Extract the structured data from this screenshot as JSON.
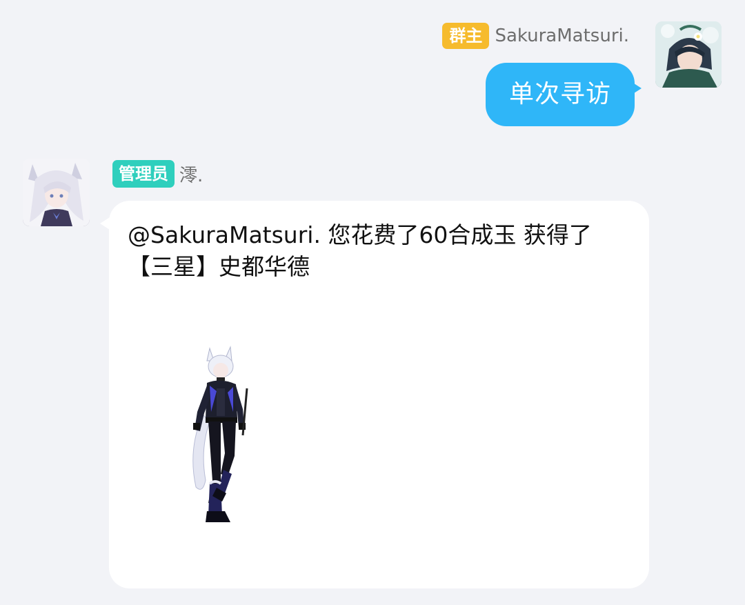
{
  "messages": {
    "outgoing": {
      "role_badge": "群主",
      "sender_name": "SakuraMatsuri.",
      "text": "单次寻访"
    },
    "incoming": {
      "role_badge": "管理员",
      "sender_name": "澪.",
      "line1": "@SakuraMatsuri. 您花费了60合成玉 获得了",
      "line2": "【三星】史都华德"
    }
  },
  "colors": {
    "background": "#f2f3f7",
    "owner_badge": "#f6bb2d",
    "admin_badge": "#2fcfbd",
    "outgoing_bubble": "#2fb6f8",
    "incoming_bubble": "#ffffff"
  }
}
